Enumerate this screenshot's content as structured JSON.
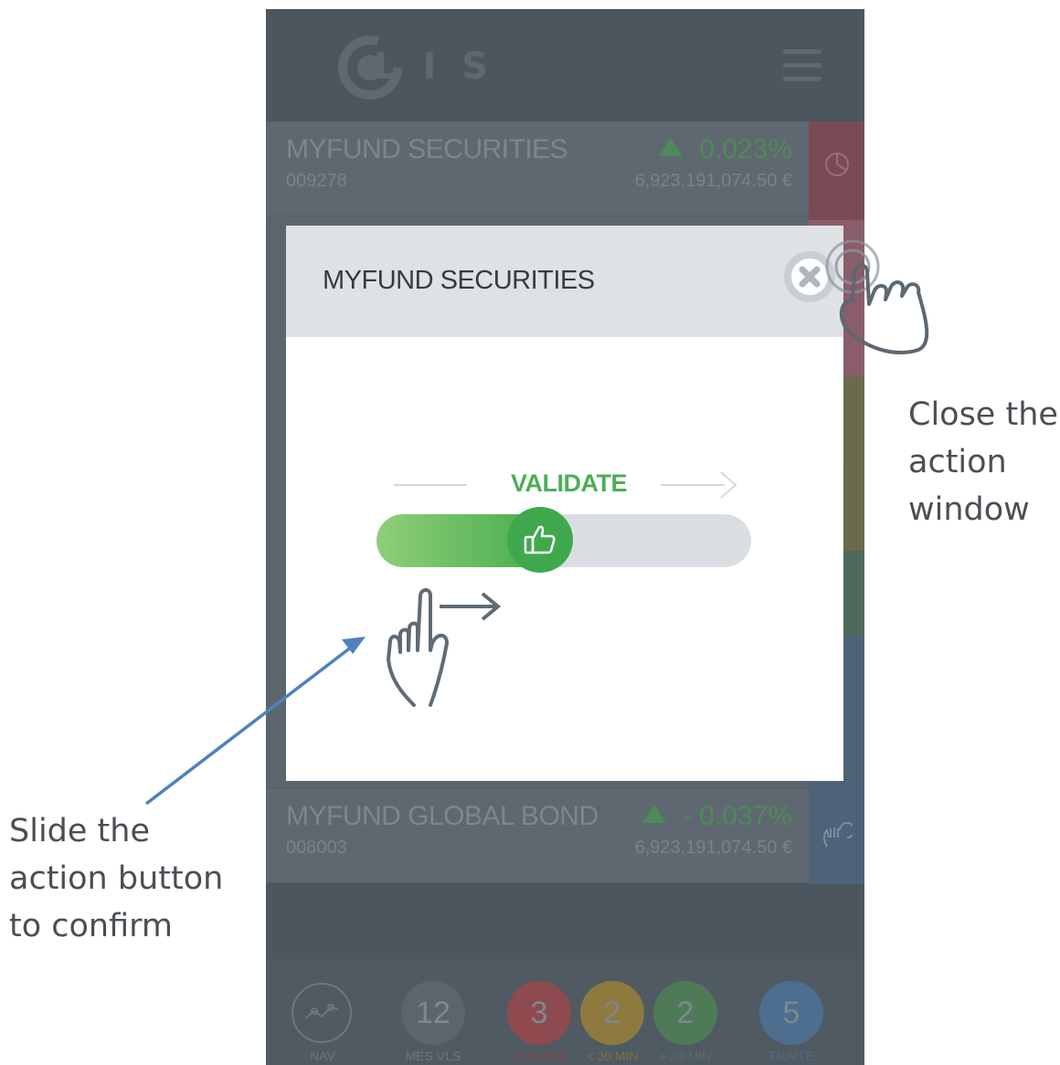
{
  "app": {
    "logo_text": "LIS"
  },
  "funds": [
    {
      "name": "MYFUND SECURITIES",
      "code": "009278",
      "change": "0.023%",
      "amount": "6,923,191,074.50 €"
    },
    {
      "name": "MYFUND GLOBAL BOND",
      "code": "008003",
      "change": "- 0.037%",
      "amount": "6,923,191,074.50 €"
    }
  ],
  "bottom_nav": {
    "nav_label": "NAV",
    "items": [
      {
        "count": "12",
        "label": "MES VLS",
        "color": "#5b656d"
      },
      {
        "count": "3",
        "label": "DEPASSE",
        "color": "#8e4a4e"
      },
      {
        "count": "2",
        "label": "< 30 MIN",
        "color": "#8e7a3e"
      },
      {
        "count": "2",
        "label": "> 30 MIN",
        "color": "#4f7a58"
      },
      {
        "count": "5",
        "label": "TRAITE",
        "color": "#4d6e8e"
      }
    ]
  },
  "modal": {
    "title": "MYFUND SECURITIES",
    "slider_label": "VALIDATE",
    "slider_progress": 0.43
  },
  "annotations": {
    "close_caption": [
      "Close the",
      "action",
      "window"
    ],
    "slide_caption": [
      "Slide the",
      "action button",
      "to confirm"
    ]
  },
  "colors": {
    "accent_green": "#4cae58",
    "overlay": "#4c565f"
  }
}
